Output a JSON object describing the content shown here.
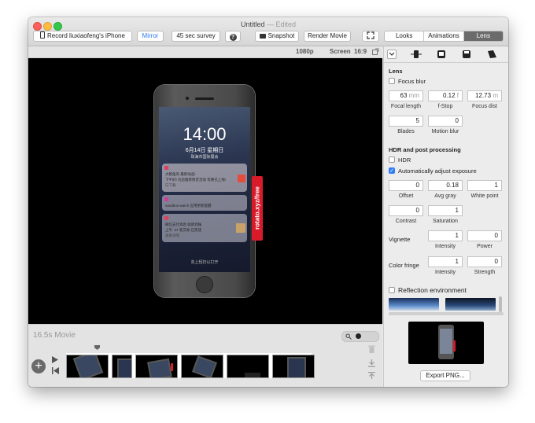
{
  "window": {
    "title": "Untitled",
    "title_suffix": "— Edited"
  },
  "toolbar": {
    "record_label": "Record liuxiaofeng's iPhone",
    "mirror_label": "Mirror",
    "survey_label": "45 sec survey",
    "help_label": "?",
    "snapshot_label": "Snapshot",
    "render_label": "Render Movie",
    "tabs": [
      "Looks",
      "Animations",
      "Lens"
    ],
    "selected_tab": "Lens"
  },
  "infobar": {
    "resolution": "1080p",
    "screen_label": "Screen",
    "aspect": "16:9"
  },
  "phone": {
    "time": "14:00",
    "date": "6月14日 星期日",
    "location": "珠海市国际展会",
    "watermark": "rotato.xyz/free",
    "notifications": [
      {
        "line1": "大鲸鱼的 最新动态!",
        "line2": "下午好! 为您推荐附近活动 优惠已上线!",
        "line3": "已下载"
      },
      {
        "line1": "sandbox-watch 应用更新提醒"
      },
      {
        "line1": "微信支付消息 收款到账",
        "line2": "上午: 37 笔交易 已完成",
        "line3": "查看详情"
      }
    ],
    "footer": "向上轻扫以打开"
  },
  "timeline": {
    "title": "16.5s Movie",
    "clips": 6
  },
  "sidebar": {
    "lens": {
      "title": "Lens",
      "focus_blur_label": "Focus blur",
      "focus_blur_checked": false,
      "focal_length": {
        "value": "63",
        "unit": "mm",
        "label": "Focal length"
      },
      "fstop": {
        "value": "0.12",
        "unit": "f",
        "label": "f-Stop"
      },
      "focus_dist": {
        "value": "12.73",
        "unit": "m",
        "label": "Focus dist"
      },
      "blades": {
        "value": "5",
        "label": "Blades"
      },
      "motion_blur": {
        "value": "0",
        "label": "Motion blur"
      }
    },
    "hdr": {
      "title": "HDR and post processing",
      "hdr_label": "HDR",
      "hdr_checked": false,
      "auto_exposure_label": "Automatically adjust exposure",
      "auto_exposure_checked": true,
      "offset": {
        "value": "0",
        "label": "Offset"
      },
      "avg_gray": {
        "value": "0.18",
        "label": "Avg gray"
      },
      "white_point": {
        "value": "1",
        "label": "White point"
      },
      "contrast": {
        "value": "0",
        "label": "Contrast"
      },
      "saturation": {
        "value": "1",
        "label": "Saturation"
      },
      "vignette": {
        "label": "Vignette",
        "intensity": "1",
        "intensity_label": "Intensity",
        "power": "0",
        "power_label": "Power"
      },
      "color_fringe": {
        "label": "Color fringe",
        "intensity": "1",
        "intensity_label": "Intensity",
        "strength": "0",
        "strength_label": "Strength"
      }
    },
    "reflection": {
      "label": "Reflection environment",
      "checked": false
    },
    "export_label": "Export PNG..."
  }
}
